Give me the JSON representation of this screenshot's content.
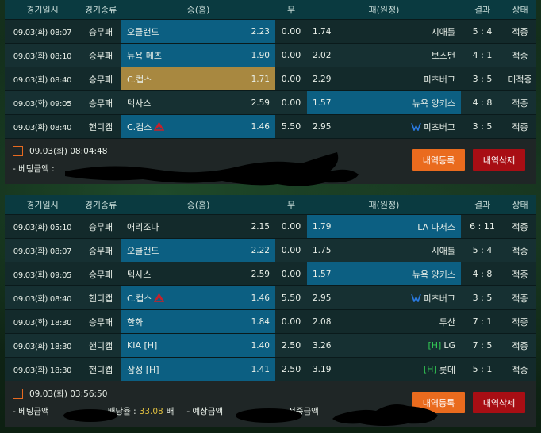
{
  "headers": {
    "time": "경기일시",
    "type": "경기종류",
    "home": "승(홈)",
    "draw": "무",
    "away": "패(원정)",
    "score": "결과",
    "status": "상태"
  },
  "bets": [
    {
      "rows": [
        {
          "time": "09.03(화) 08:07",
          "type": "승무패",
          "home": "오클랜드",
          "home_odds": "2.23",
          "draw": "0.00",
          "away_odds": "1.74",
          "away": "시애틀",
          "score": "5 : 4",
          "status": "적중",
          "selected": "home"
        },
        {
          "time": "09.03(화) 08:10",
          "type": "승무패",
          "home": "뉴욕 메츠",
          "home_odds": "1.90",
          "draw": "0.00",
          "away_odds": "2.02",
          "away": "보스턴",
          "score": "4 : 1",
          "status": "적중",
          "selected": "home"
        },
        {
          "time": "09.03(화) 08:40",
          "type": "승무패",
          "home": "C.컵스",
          "home_odds": "1.71",
          "draw": "0.00",
          "away_odds": "2.29",
          "away": "피츠버그",
          "score": "3 : 5",
          "status": "미적중",
          "selected": "home-miss"
        },
        {
          "time": "09.03(화) 09:05",
          "type": "승무패",
          "home": "텍사스",
          "home_odds": "2.59",
          "draw": "0.00",
          "away_odds": "1.57",
          "away": "뉴욕 양키스",
          "score": "4 : 8",
          "status": "적중",
          "selected": "away"
        },
        {
          "time": "09.03(화) 08:40",
          "type": "핸디캡",
          "home": "C.컵스",
          "home_odds": "1.46",
          "draw": "5.50",
          "away_odds": "2.95",
          "away": "피츠버그",
          "score": "3 : 5",
          "status": "적중",
          "selected": "home",
          "home_logo": "cubs-logo-icon",
          "away_logo": "pirates-logo-icon"
        }
      ],
      "footer": {
        "datetime": "09.03(화) 08:04:48",
        "bet_amount_label": "- 베팅금액 : ",
        "register_label": "내역등록",
        "delete_label": "내역삭제"
      }
    },
    {
      "rows": [
        {
          "time": "09.03(화) 05:10",
          "type": "승무패",
          "home": "애리조나",
          "home_odds": "2.15",
          "draw": "0.00",
          "away_odds": "1.79",
          "away": "LA 다저스",
          "score": "6 : 11",
          "status": "적중",
          "selected": "away"
        },
        {
          "time": "09.03(화) 08:07",
          "type": "승무패",
          "home": "오클랜드",
          "home_odds": "2.22",
          "draw": "0.00",
          "away_odds": "1.75",
          "away": "시애틀",
          "score": "5 : 4",
          "status": "적중",
          "selected": "home"
        },
        {
          "time": "09.03(화) 09:05",
          "type": "승무패",
          "home": "텍사스",
          "home_odds": "2.59",
          "draw": "0.00",
          "away_odds": "1.57",
          "away": "뉴욕 양키스",
          "score": "4 : 8",
          "status": "적중",
          "selected": "away"
        },
        {
          "time": "09.03(화) 08:40",
          "type": "핸디캡",
          "home": "C.컵스",
          "home_odds": "1.46",
          "draw": "5.50",
          "away_odds": "2.95",
          "away": "피츠버그",
          "score": "3 : 5",
          "status": "적중",
          "selected": "home",
          "home_logo": "cubs-logo-icon",
          "away_logo": "pirates-logo-icon"
        },
        {
          "time": "09.03(화) 18:30",
          "type": "승무패",
          "home": "한화",
          "home_odds": "1.84",
          "draw": "0.00",
          "away_odds": "2.08",
          "away": "두산",
          "score": "7 : 1",
          "status": "적중",
          "selected": "home"
        },
        {
          "time": "09.03(화) 18:30",
          "type": "핸디캡",
          "home": "KIA [H]",
          "home_odds": "1.40",
          "draw": "2.50",
          "away_odds": "3.26",
          "away": "LG",
          "away_badge": "[H]",
          "score": "7 : 5",
          "status": "적중",
          "selected": "home"
        },
        {
          "time": "09.03(화) 18:30",
          "type": "핸디캡",
          "home": "삼성 [H]",
          "home_odds": "1.41",
          "draw": "2.50",
          "away_odds": "3.19",
          "away": "롯데",
          "away_badge": "[H]",
          "score": "5 : 1",
          "status": "적중",
          "selected": "home"
        }
      ],
      "footer": {
        "datetime": "09.03(화) 03:56:50",
        "bet_amount_label": "- 베팅금액",
        "rate_label": "배당율 : ",
        "rate_value": "33.08",
        "rate_unit": "배",
        "expected_label": "- 예상금액",
        "win_label": "적중금액",
        "register_label": "내역등록",
        "delete_label": "내역삭제"
      }
    }
  ],
  "colors": {
    "selected": "#0c5f82",
    "selected_miss": "#a88840",
    "register_button": "#ea6b1e",
    "delete_button": "#a80e14",
    "handicap_badge": "#33cc55"
  }
}
